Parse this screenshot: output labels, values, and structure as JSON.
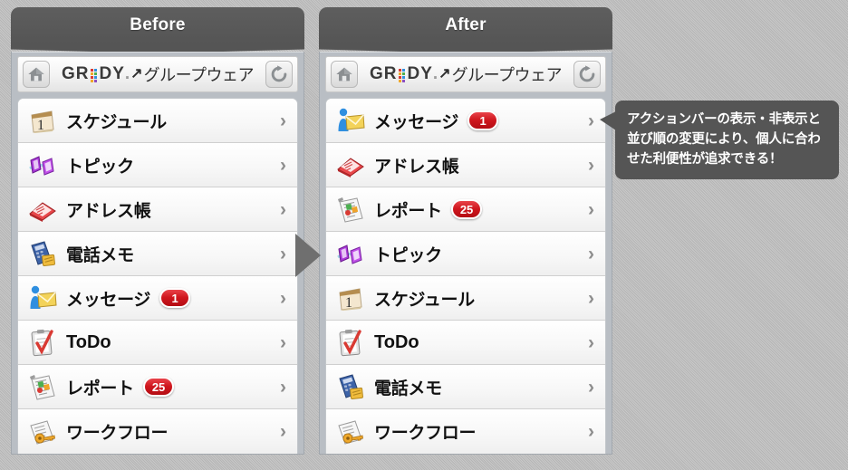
{
  "panels": [
    {
      "id": "before",
      "tab_label": "Before",
      "appbar": {
        "home_icon": "home-icon",
        "refresh_icon": "refresh-icon",
        "logo": {
          "part1": "GR",
          "part2": "DY",
          "dot": ".",
          "arrow": "↗",
          "jp": "グループウェア"
        }
      },
      "items": [
        {
          "label": "スケジュール",
          "icon": "calendar-icon",
          "badge": null,
          "latin": false
        },
        {
          "label": "トピック",
          "icon": "topic-icon",
          "badge": null,
          "latin": false
        },
        {
          "label": "アドレス帳",
          "icon": "addressbook-icon",
          "badge": null,
          "latin": false
        },
        {
          "label": "電話メモ",
          "icon": "phonememo-icon",
          "badge": null,
          "latin": false
        },
        {
          "label": "メッセージ",
          "icon": "message-icon",
          "badge": "1",
          "latin": false
        },
        {
          "label": "ToDo",
          "icon": "todo-icon",
          "badge": null,
          "latin": true
        },
        {
          "label": "レポート",
          "icon": "report-icon",
          "badge": "25",
          "latin": false
        },
        {
          "label": "ワークフロー",
          "icon": "workflow-icon",
          "badge": null,
          "latin": false
        }
      ]
    },
    {
      "id": "after",
      "tab_label": "After",
      "appbar": {
        "home_icon": "home-icon",
        "refresh_icon": "refresh-icon",
        "logo": {
          "part1": "GR",
          "part2": "DY",
          "dot": ".",
          "arrow": "↗",
          "jp": "グループウェア"
        }
      },
      "items": [
        {
          "label": "メッセージ",
          "icon": "message-icon",
          "badge": "1",
          "latin": false
        },
        {
          "label": "アドレス帳",
          "icon": "addressbook-icon",
          "badge": null,
          "latin": false
        },
        {
          "label": "レポート",
          "icon": "report-icon",
          "badge": "25",
          "latin": false
        },
        {
          "label": "トピック",
          "icon": "topic-icon",
          "badge": null,
          "latin": false
        },
        {
          "label": "スケジュール",
          "icon": "calendar-icon",
          "badge": null,
          "latin": false
        },
        {
          "label": "ToDo",
          "icon": "todo-icon",
          "badge": null,
          "latin": true
        },
        {
          "label": "電話メモ",
          "icon": "phonememo-icon",
          "badge": null,
          "latin": false
        },
        {
          "label": "ワークフロー",
          "icon": "workflow-icon",
          "badge": null,
          "latin": false
        }
      ]
    }
  ],
  "transition_arrow": "right-triangle-arrow",
  "callout": {
    "text": "アクションバーの表示・非表示と並び順の変更により、個人に合わせた利便性が追求できる！"
  },
  "colors": {
    "tab_bg": "#555555",
    "badge_red": "#cf161d",
    "chevron": "#8d8d8d",
    "background": "#bfbfbf"
  }
}
